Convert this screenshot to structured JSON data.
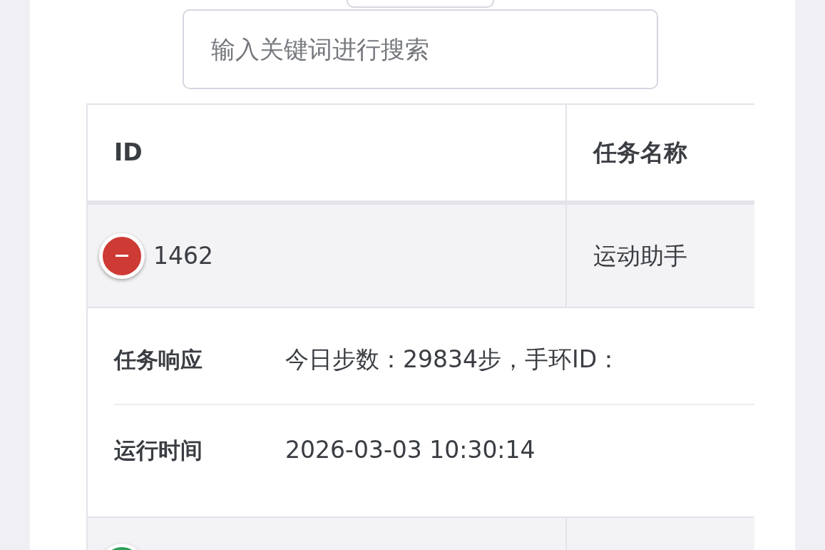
{
  "search": {
    "placeholder": "输入关键词进行搜索"
  },
  "table": {
    "columns": [
      "ID",
      "任务名称"
    ],
    "rows": [
      {
        "id": "1462",
        "task_name": "运动助手",
        "expanded": true,
        "details": [
          {
            "label": "任务响应",
            "value": "今日步数：29834步，手环ID："
          },
          {
            "label": "运行时间",
            "value": "2026-03-03 10:30:14"
          }
        ]
      },
      {
        "expanded": false
      }
    ]
  }
}
